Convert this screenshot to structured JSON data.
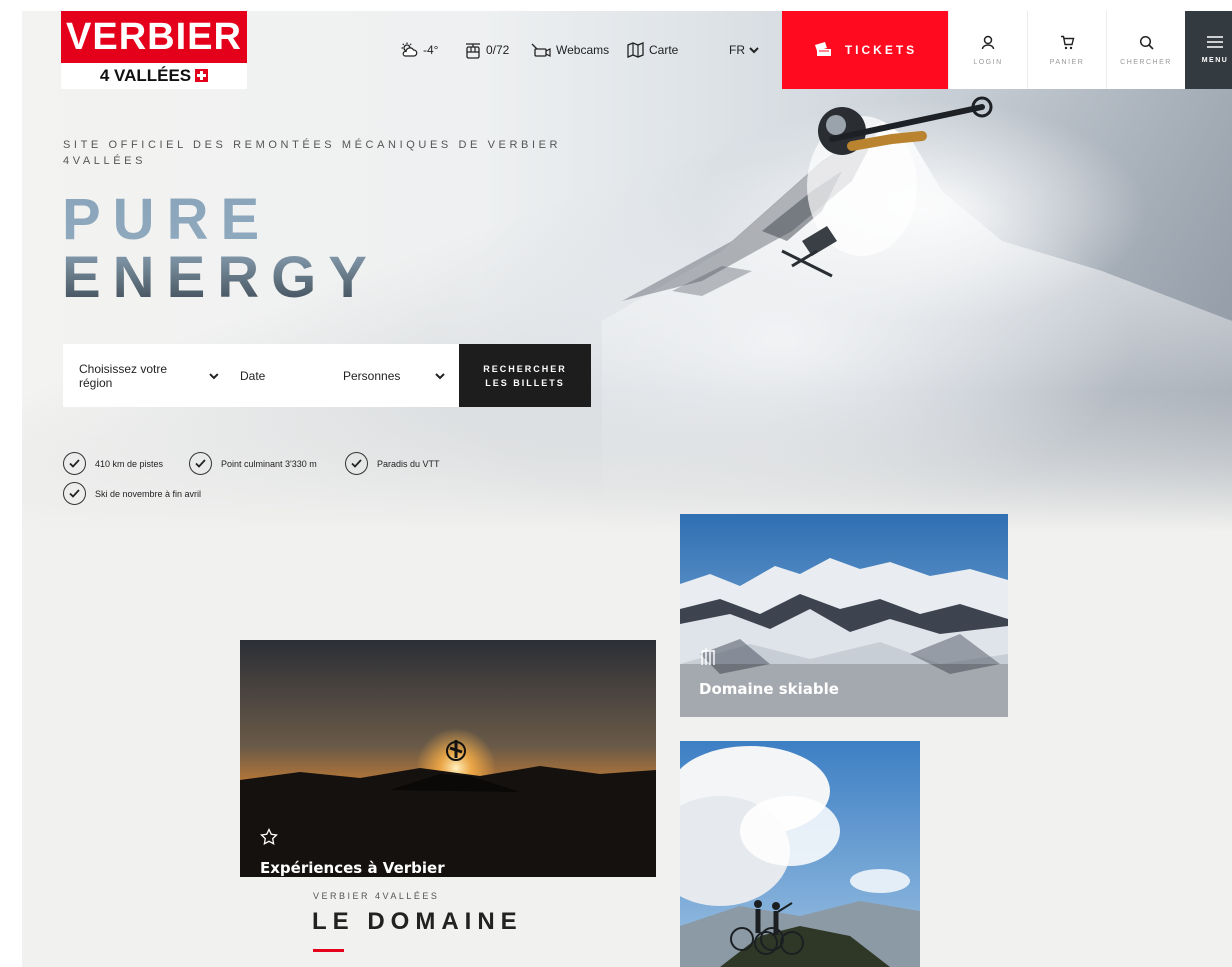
{
  "brand": {
    "logo_top": "VERBIER",
    "logo_bottom": "4 VALLÉES"
  },
  "topnav": {
    "weather": "-4°",
    "lifts": "0/72",
    "webcams": "Webcams",
    "map": "Carte",
    "language": "FR"
  },
  "header": {
    "tickets": "TICKETS",
    "login": "LOGIN",
    "cart": "PANIER",
    "search": "CHERCHER",
    "menu": "MENU"
  },
  "hero": {
    "tagline": "SITE OFFICIEL DES REMONTÉES MÉCANIQUES DE VERBIER 4VALLÉES",
    "headline_line1": "PURE",
    "headline_line2": "ENERGY"
  },
  "booking": {
    "region": "Choisissez votre région",
    "date": "Date",
    "persons": "Personnes",
    "button_line1": "RECHERCHER",
    "button_line2": "LES BILLETS"
  },
  "features": [
    "410 km de pistes",
    "Point culminant 3'330 m",
    "Paradis du VTT",
    "Ski de novembre à fin avril"
  ],
  "cards": {
    "domaine": "Domaine skiable",
    "experiences": "Expériences à Verbier"
  },
  "section": {
    "kicker": "VERBIER 4VALLÉES",
    "title": "LE DOMAINE"
  },
  "colors": {
    "brand_red": "#e4001b",
    "tickets_red": "#ff0a1e",
    "menu_dark": "#333a40",
    "button_dark": "#1d1d1d"
  }
}
